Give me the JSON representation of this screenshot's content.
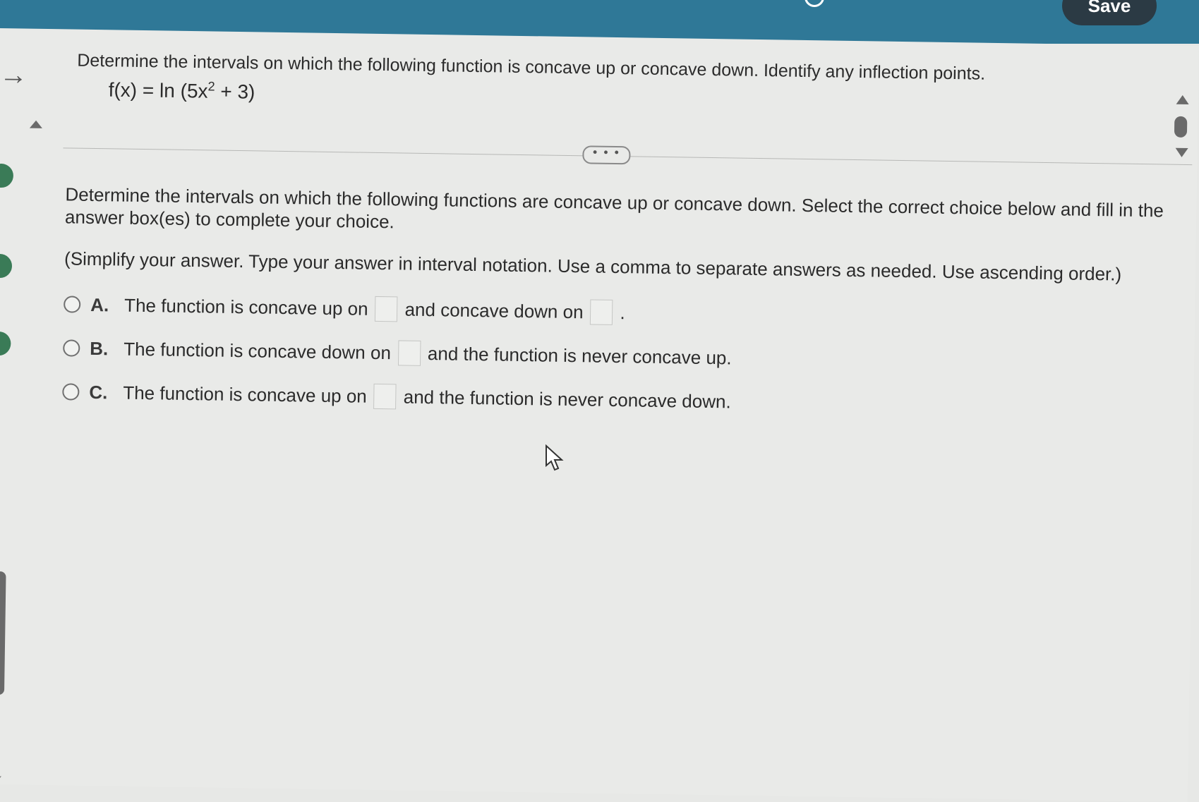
{
  "header": {
    "save_label": "Save"
  },
  "question": {
    "prompt": "Determine the intervals on which the following function is concave up or concave down. Identify any inflection points.",
    "function_lhs": "f(x) = ln",
    "function_inner_open": "(5x",
    "function_exponent": "2",
    "function_inner_close": " + 3)"
  },
  "more_button": {
    "label": "• • •"
  },
  "instructions": {
    "main": "Determine the intervals on which the following functions are concave up or concave down. Select the correct choice below and fill in the answer box(es) to complete your choice.",
    "simplify": "(Simplify your answer. Type your answer in interval notation. Use a comma to separate answers as needed. Use ascending order.)"
  },
  "choices": [
    {
      "letter": "A.",
      "text_before": "The function is concave up on",
      "text_middle": "and concave down on",
      "text_after": "."
    },
    {
      "letter": "B.",
      "text_before": "The function is concave down on",
      "text_after": "and the function is never concave up."
    },
    {
      "letter": "C.",
      "text_before": "The function is concave up on",
      "text_after": "and the function is never concave down."
    }
  ],
  "answers": {
    "a_up": "",
    "a_down": "",
    "b_down": "",
    "c_up": ""
  }
}
